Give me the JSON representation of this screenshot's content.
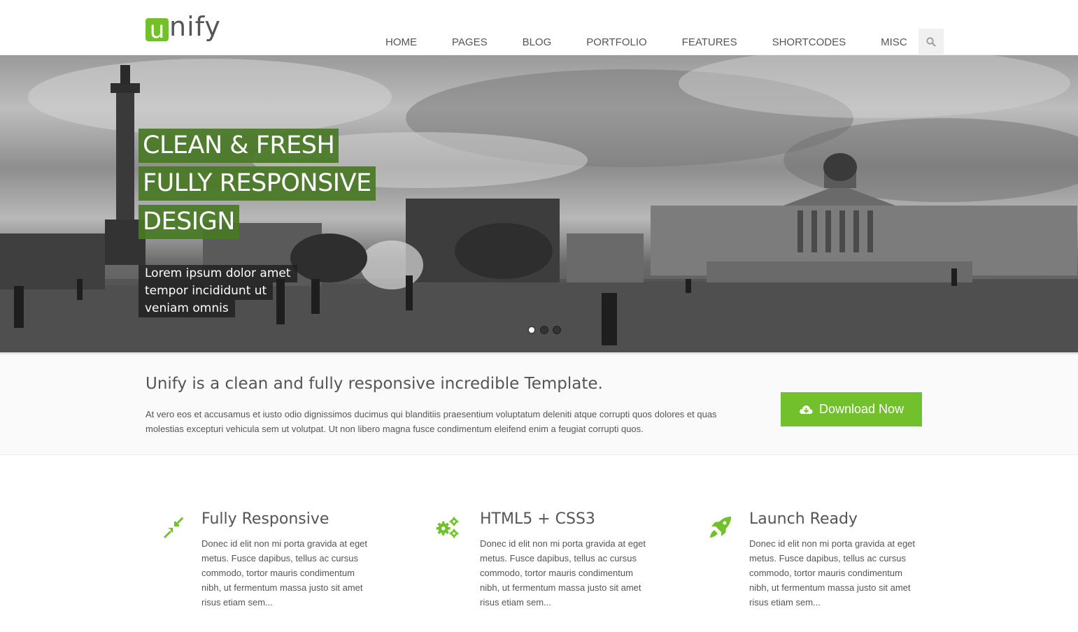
{
  "header": {
    "logo_letter": "u",
    "logo_rest": "nify",
    "nav": [
      "HOME",
      "PAGES",
      "BLOG",
      "PORTFOLIO",
      "FEATURES",
      "SHORTCODES",
      "MISC"
    ],
    "search_icon": "search-icon"
  },
  "hero": {
    "headline_lines": [
      "CLEAN & FRESH",
      "FULLY RESPONSIVE",
      "DESIGN"
    ],
    "subline_lines": [
      "Lorem ipsum dolor amet",
      "tempor incididunt ut",
      "veniam omnis"
    ],
    "slide_count": 3,
    "active_slide": 1
  },
  "promo": {
    "title": "Unify is a clean and fully responsive incredible Template.",
    "text": "At vero eos et accusamus et iusto odio dignissimos ducimus qui blanditiis praesentium voluptatum deleniti atque corrupti quos dolores et quas molestias excepturi vehicula sem ut volutpat. Ut non libero magna fusce condimentum eleifend enim a feugiat corrupti quos.",
    "button_label": "Download Now",
    "button_icon": "cloud-download-icon"
  },
  "features": [
    {
      "icon": "compress-arrows-icon",
      "title": "Fully Responsive",
      "text": "Donec id elit non mi porta gravida at eget metus. Fusce dapibus, tellus ac cursus commodo, tortor mauris condimentum nibh, ut fermentum massa justo sit amet risus etiam sem..."
    },
    {
      "icon": "gears-icon",
      "title": "HTML5 + CSS3",
      "text": "Donec id elit non mi porta gravida at eget metus. Fusce dapibus, tellus ac cursus commodo, tortor mauris condimentum nibh, ut fermentum massa justo sit amet risus etiam sem..."
    },
    {
      "icon": "rocket-icon",
      "title": "Launch Ready",
      "text": "Donec id elit non mi porta gravida at eget metus. Fusce dapibus, tellus ac cursus commodo, tortor mauris condimentum nibh, ut fermentum massa justo sit amet risus etiam sem..."
    }
  ],
  "colors": {
    "accent": "#72c02c",
    "headline_bg": "#487824",
    "text": "#555555"
  }
}
